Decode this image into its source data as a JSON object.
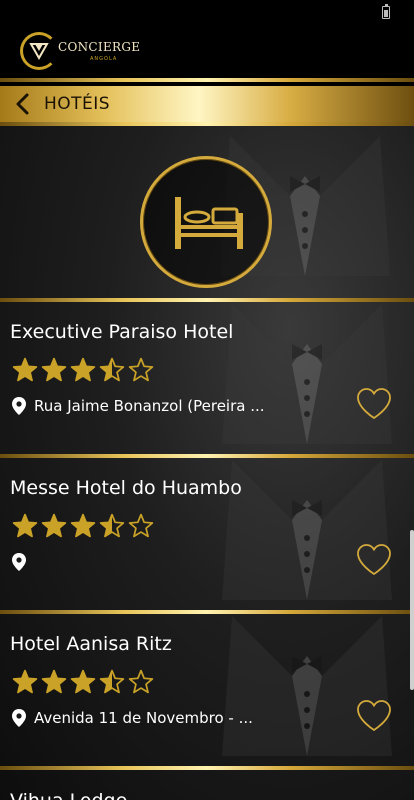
{
  "app": {
    "brand": "CONCIERGE",
    "brand_sub": "ANGOLA"
  },
  "header": {
    "title": "HOTÉIS"
  },
  "hero": {
    "icon": "bed-icon"
  },
  "hotels": [
    {
      "name": "Executive Paraiso Hotel",
      "rating": 3.5,
      "address": "Rua Jaime Bonanzol (Pereira ..."
    },
    {
      "name": "Messe Hotel do Huambo",
      "rating": 3.5,
      "address": ""
    },
    {
      "name": "Hotel Aanisa Ritz",
      "rating": 3.5,
      "address": "Avenida 11 de Novembro - ..."
    },
    {
      "name": "Vihua Lodge"
    }
  ],
  "colors": {
    "gold": "#d4aa3c",
    "gold_light": "#fff2b0",
    "background": "#1e1e1e",
    "star": "#c9a227"
  }
}
